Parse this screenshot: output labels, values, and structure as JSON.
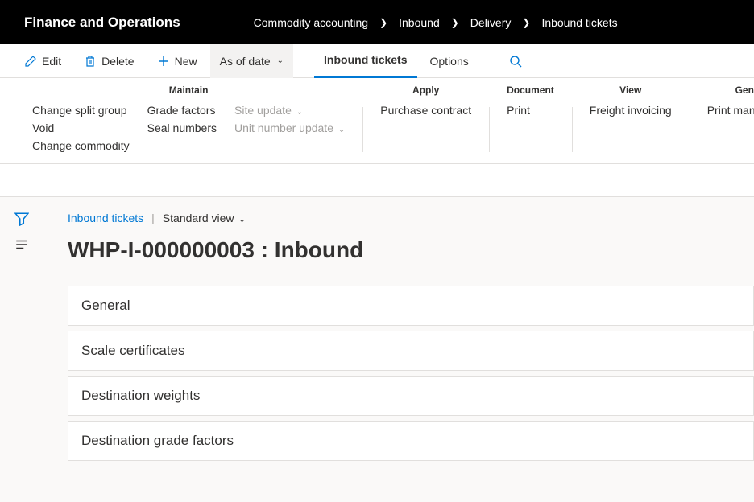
{
  "header": {
    "app_title": "Finance and Operations",
    "breadcrumb": [
      "Commodity accounting",
      "Inbound",
      "Delivery",
      "Inbound tickets"
    ]
  },
  "actions": {
    "edit": "Edit",
    "delete": "Delete",
    "new": "New",
    "as_of_date": "As of date",
    "inbound_tickets": "Inbound tickets",
    "options": "Options"
  },
  "ribbon": {
    "maintain": {
      "title": "Maintain",
      "col1": [
        "Change split group",
        "Void",
        "Change commodity"
      ],
      "col2": [
        "Grade factors",
        "Seal numbers"
      ],
      "col3": [
        "Site update",
        "Unit number update"
      ]
    },
    "apply": {
      "title": "Apply",
      "items": [
        "Purchase contract"
      ]
    },
    "document": {
      "title": "Document",
      "items": [
        "Print"
      ]
    },
    "view": {
      "title": "View",
      "items": [
        "Freight invoicing"
      ]
    },
    "general": {
      "title": "General",
      "items": [
        "Print management"
      ]
    }
  },
  "page": {
    "back_link": "Inbound tickets",
    "view_name": "Standard view",
    "title": "WHP-I-000000003 : Inbound",
    "panels": [
      "General",
      "Scale certificates",
      "Destination weights",
      "Destination grade factors"
    ]
  }
}
